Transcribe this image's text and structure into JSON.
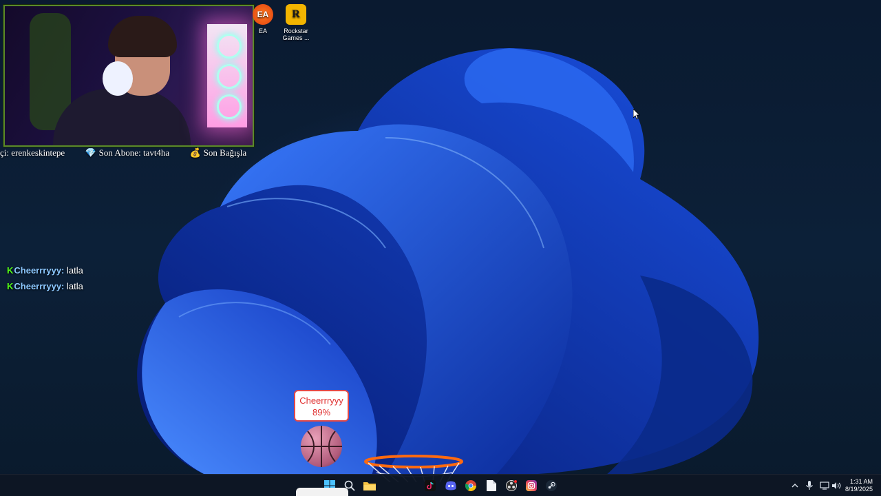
{
  "desktop_icons": [
    {
      "label": "EA",
      "icon": "ea-icon"
    },
    {
      "label": "Rockstar Games ...",
      "icon": "rockstar-icon"
    }
  ],
  "ticker": {
    "top_viewer": "çi: erenkeskintepe",
    "last_sub": "Son Abone: tavt4ha",
    "last_donation": "Son Bağışla"
  },
  "chat": {
    "messages": [
      {
        "user": "Cheerrryyy:",
        "text": "latla"
      },
      {
        "user": "Cheerrryyy:",
        "text": "latla"
      }
    ]
  },
  "basketball": {
    "player": "Cheerrryyy",
    "percent": "89%"
  },
  "taskbar": {
    "icons": [
      "windows-start-icon",
      "search-icon",
      "file-explorer-icon",
      "tiktok-icon",
      "discord-icon",
      "chrome-icon",
      "document-icon",
      "obs-icon",
      "instagram-icon",
      "steam-icon"
    ],
    "time": "1:31 AM",
    "date": "8/19/2025"
  },
  "colors": {
    "accent_green": "#53fc18",
    "chat_user": "#8cc8ff",
    "ball_label_red": "#e03030",
    "taskbar_bg": "#0e1624"
  }
}
